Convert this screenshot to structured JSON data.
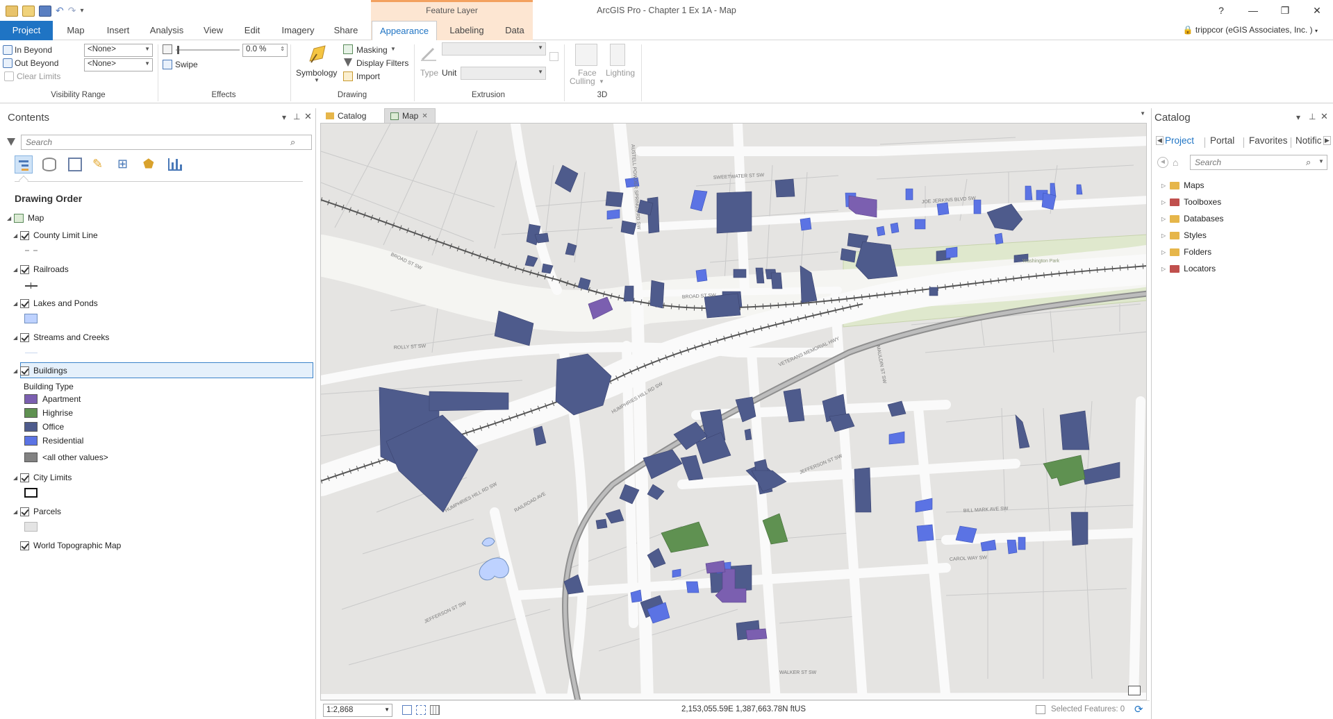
{
  "app": {
    "title": "ArcGIS Pro - Chapter 1 Ex 1A - Map",
    "context_tab_group": "Feature Layer",
    "window_buttons": [
      "?",
      "—",
      "❐",
      "✕"
    ],
    "user": "trippcor (eGIS Associates, Inc. )"
  },
  "tabs": [
    "Project",
    "Map",
    "Insert",
    "Analysis",
    "View",
    "Edit",
    "Imagery",
    "Share",
    "Appearance",
    "Labeling",
    "Data"
  ],
  "active_tab": "Appearance",
  "ribbon": {
    "visibility": {
      "in_beyond": "In Beyond",
      "out_beyond": "Out Beyond",
      "clear_limits": "Clear Limits",
      "in_value": "<None>",
      "out_value": "<None>",
      "group": "Visibility Range"
    },
    "effects": {
      "transparency": "0.0 %",
      "swipe": "Swipe",
      "group": "Effects"
    },
    "drawing": {
      "symbology": "Symbology",
      "masking": "Masking",
      "display_filters": "Display Filters",
      "import": "Import",
      "group": "Drawing"
    },
    "extrusion": {
      "type": "Type",
      "unit": "Unit",
      "group": "Extrusion"
    },
    "three_d": {
      "face_culling_1": "Face",
      "face_culling_2": "Culling",
      "lighting": "Lighting",
      "group": "3D"
    }
  },
  "contents": {
    "title": "Contents",
    "search_placeholder": "Search",
    "drawing_order": "Drawing Order",
    "map_label": "Map",
    "layers": {
      "county": "County Limit Line",
      "railroads": "Railroads",
      "lakes": "Lakes and Ponds",
      "streams": "Streams and Creeks",
      "buildings": "Buildings",
      "city": "City Limits",
      "parcels": "Parcels",
      "basemap": "World Topographic Map"
    },
    "building_type_heading": "Building Type",
    "legend": [
      {
        "label": "Apartment",
        "color": "#7b5fb0"
      },
      {
        "label": "Highrise",
        "color": "#5f9151"
      },
      {
        "label": "Office",
        "color": "#4e5b8c"
      },
      {
        "label": "Residential",
        "color": "#5b73e4"
      },
      {
        "label": "<all other values>",
        "color": "#828282"
      }
    ]
  },
  "map_view": {
    "tabs": [
      "Catalog",
      "Map"
    ],
    "scale": "1:2,868",
    "coordinates": "2,153,055.59E 1,387,663.78N ftUS",
    "selected": "Selected Features: 0"
  },
  "catalog": {
    "title": "Catalog",
    "tabs": [
      "Project",
      "Portal",
      "Favorites",
      "Notific"
    ],
    "search_placeholder": "Search",
    "items": [
      {
        "label": "Maps",
        "color": "#e6b64a"
      },
      {
        "label": "Toolboxes",
        "color": "#c0504d"
      },
      {
        "label": "Databases",
        "color": "#e6b64a"
      },
      {
        "label": "Styles",
        "color": "#e6b64a"
      },
      {
        "label": "Folders",
        "color": "#e6b64a"
      },
      {
        "label": "Locators",
        "color": "#c0504d"
      }
    ]
  },
  "map_labels": [
    "SWEETWATER ST SW",
    "JOE JERKINS BLVD SW",
    "BROAD ST SW",
    "HUMPHRIES HILL RD SW",
    "ROLLY ST SW",
    "VETERANS MEMORIAL HWY",
    "JEFFERSON ST SW",
    "BILL MARK AVE SW",
    "CAROL WAY SW",
    "RAILROAD AVE",
    "WALKER ST SW",
    "MAULDIN ST SW",
    "AUSTELL POWDER SPRINGS RD SW",
    "Washington Park"
  ]
}
